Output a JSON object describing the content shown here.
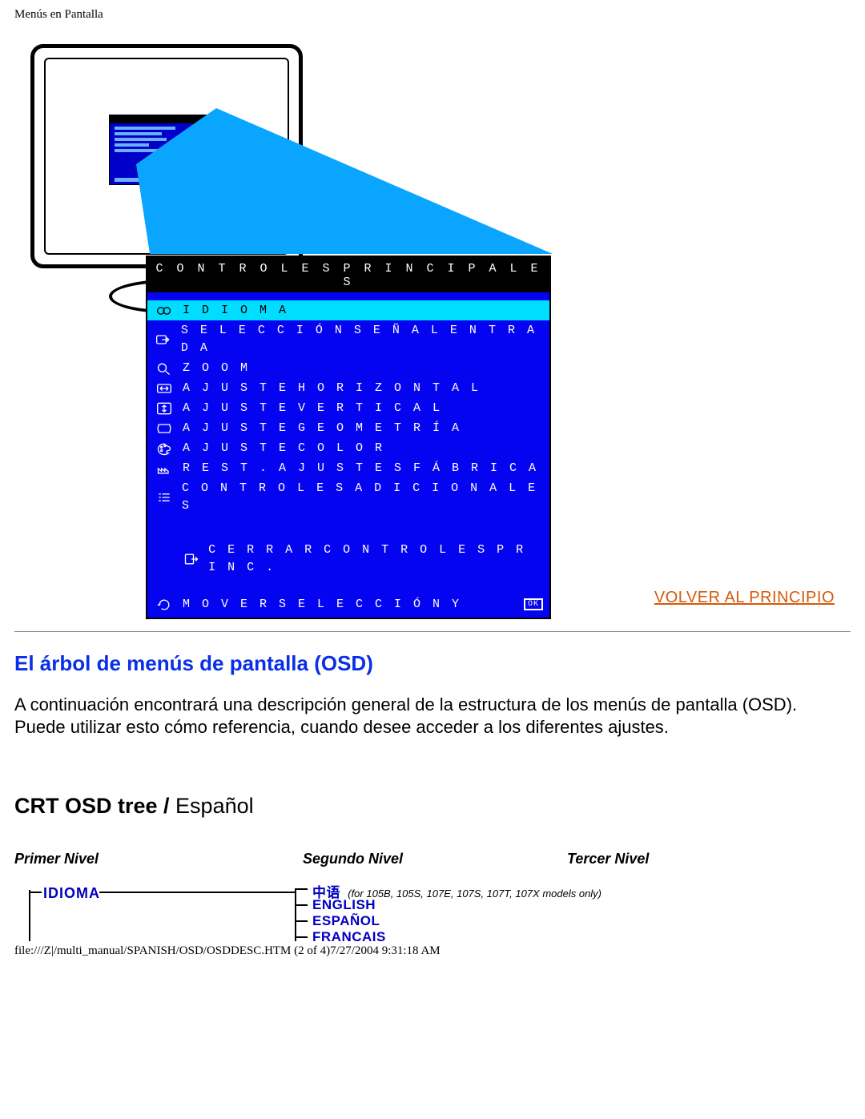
{
  "header_crumb": "Menús en Pantalla",
  "osd": {
    "title": "C O N T R O L E S  P R I N C I P A L E S",
    "items": [
      "I D I O M A",
      "S E L E C C I Ó N  S E Ñ A L  E N T R A D A",
      "Z O O M",
      "A J U S T E   H O R I Z O N T A L",
      "A J U S T E   V E R T I C A L",
      "A J U S T E   G E O M E T R Í A",
      "A J U S T E   C O L O R",
      "R E S T .   A J U S T E S   F Á B R I C A",
      "C O N T R O L E S   A D I C I O N A L E S"
    ],
    "close": "C E R R A R   C O N T R O L E S   P R I N C .",
    "footer": "M O V E R   S E L E C C I Ó N   Y",
    "ok": "OK"
  },
  "link_top": "VOLVER AL PRINCIPIO",
  "section_heading": "El árbol de menús de pantalla (OSD)",
  "body_text": "A continuación encontrará una descripción general de la estructura de los menús de pantalla (OSD). Puede utilizar esto cómo referencia, cuando desee acceder a los diferentes ajustes.",
  "tree_title_bold": "CRT OSD tree /",
  "tree_title_rest": " Español",
  "levels": {
    "l1": "Primer Nivel",
    "l2": "Segundo Nivel",
    "l3": "Tercer Nivel"
  },
  "tree": {
    "l1_item": "IDIOMA",
    "languages": [
      {
        "label": "中语",
        "note": "(for 105B, 105S, 107E, 107S, 107T, 107X models only)"
      },
      {
        "label": "ENGLISH",
        "note": ""
      },
      {
        "label": "ESPAÑOL",
        "note": ""
      },
      {
        "label": "FRANCAIS",
        "note": ""
      }
    ]
  },
  "footer_path": "file:///Z|/multi_manual/SPANISH/OSD/OSDDESC.HTM (2 of 4)7/27/2004 9:31:18 AM"
}
